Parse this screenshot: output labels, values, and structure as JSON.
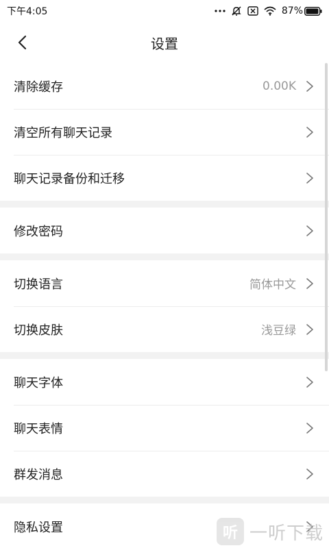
{
  "status_bar": {
    "time": "下午4:05",
    "battery_percent": "87%",
    "icons": [
      "more-dots-icon",
      "mute-icon",
      "sim-x-icon",
      "wifi-icon",
      "battery-icon"
    ]
  },
  "header": {
    "title": "设置",
    "back_icon": "chevron-left-icon"
  },
  "groups": [
    {
      "items": [
        {
          "label": "清除缓存",
          "value": "0.00K"
        },
        {
          "label": "清空所有聊天记录",
          "value": ""
        },
        {
          "label": "聊天记录备份和迁移",
          "value": ""
        }
      ]
    },
    {
      "items": [
        {
          "label": "修改密码",
          "value": ""
        }
      ]
    },
    {
      "items": [
        {
          "label": "切换语言",
          "value": "简体中文"
        },
        {
          "label": "切换皮肤",
          "value": "浅豆绿"
        }
      ]
    },
    {
      "items": [
        {
          "label": "聊天字体",
          "value": ""
        },
        {
          "label": "聊天表情",
          "value": ""
        },
        {
          "label": "群发消息",
          "value": ""
        }
      ]
    },
    {
      "items": [
        {
          "label": "隐私设置",
          "value": ""
        }
      ]
    }
  ],
  "watermark": {
    "logo_char": "听",
    "text": "一听下载"
  },
  "colors": {
    "divider": "#ececec",
    "group_gap": "#f2f2f2",
    "value_text": "#999999",
    "label_text": "#222222"
  }
}
